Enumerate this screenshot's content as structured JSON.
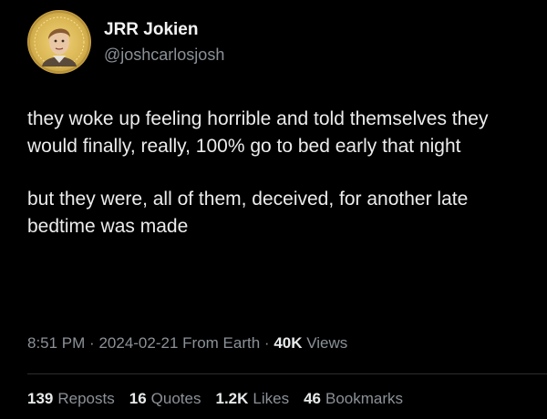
{
  "author": {
    "display_name": "JRR Jokien",
    "handle": "@joshcarlosjosh"
  },
  "tweet": {
    "paragraphs": [
      "they woke up feeling horrible and told themselves they would finally, really, 100% go to bed early that night",
      "but they were, all of them, deceived, for another late bedtime was made"
    ]
  },
  "meta": {
    "time": "8:51 PM",
    "separator": "·",
    "date": "2024-02-21",
    "source": "From Earth",
    "views_count": "40K",
    "views_label": "Views"
  },
  "stats": {
    "reposts_count": "139",
    "reposts_label": "Reposts",
    "quotes_count": "16",
    "quotes_label": "Quotes",
    "likes_count": "1.2K",
    "likes_label": "Likes",
    "bookmarks_count": "46",
    "bookmarks_label": "Bookmarks"
  },
  "colors": {
    "background": "#000000",
    "primary_text": "#e7e9ea",
    "secondary_text": "#8b9197",
    "avatar_gold": "#d9b451"
  },
  "icons": {
    "avatar": "profile-portrait-gold-halo"
  }
}
